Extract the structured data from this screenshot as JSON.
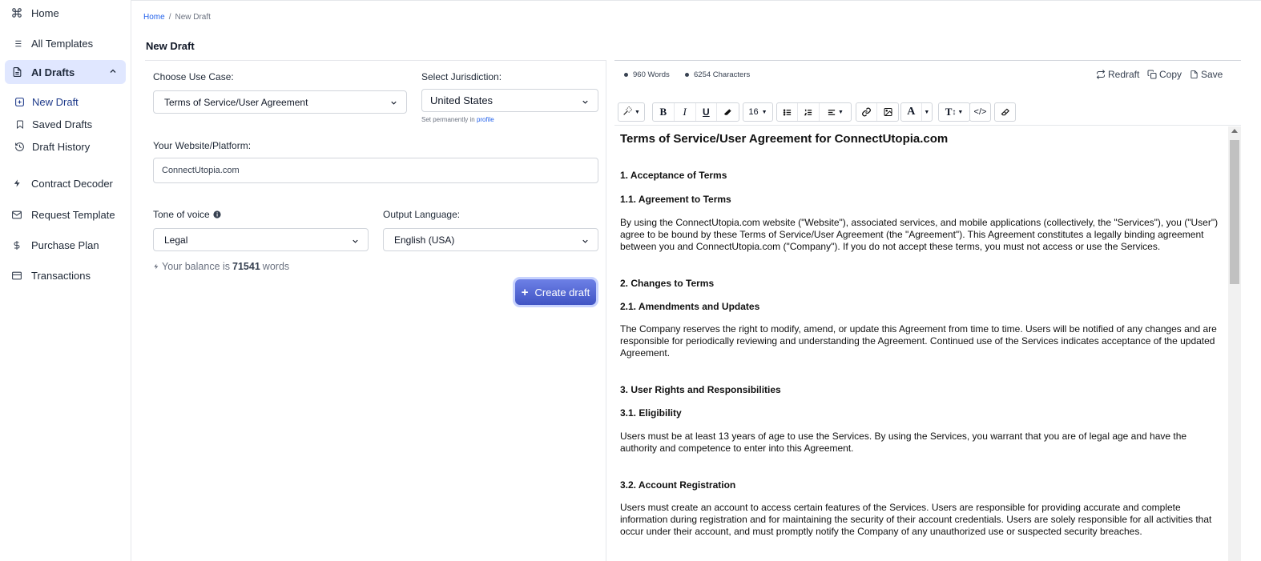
{
  "sidebar": {
    "items": [
      {
        "label": "Home"
      },
      {
        "label": "All Templates"
      },
      {
        "label": "AI Drafts"
      },
      {
        "label": "Contract Decoder"
      },
      {
        "label": "Request Template"
      },
      {
        "label": "Purchase Plan"
      },
      {
        "label": "Transactions"
      }
    ],
    "sub_items": [
      {
        "label": "New Draft"
      },
      {
        "label": "Saved Drafts"
      },
      {
        "label": "Draft History"
      }
    ]
  },
  "breadcrumb": {
    "home": "Home",
    "separator": "/",
    "current": "New Draft"
  },
  "page_title": "New Draft",
  "form": {
    "use_case_label": "Choose Use Case:",
    "use_case_value": "Terms of Service/User Agreement",
    "jurisdiction_label": "Select Jurisdiction:",
    "jurisdiction_value": "United States",
    "jurisdiction_hint": "Set permanently in",
    "jurisdiction_hint_link": "profile",
    "website_label": "Your Website/Platform:",
    "website_value": "ConnectUtopia.com",
    "tone_label": "Tone of voice",
    "tone_value": "Legal",
    "language_label": "Output Language:",
    "language_value": "English (USA)",
    "balance_prefix": "Your balance is",
    "balance_value": "71541",
    "balance_suffix": "words",
    "create_button": "Create draft"
  },
  "editor": {
    "words": "960 Words",
    "characters": "6254 Characters",
    "redraft": "Redraft",
    "copy": "Copy",
    "save": "Save",
    "font_size": "16",
    "document": {
      "title": "Terms of Service/User Agreement for ConnectUtopia.com",
      "s1": "1. Acceptance of Terms",
      "s1_1": "1.1. Agreement to Terms",
      "p1": "By using the ConnectUtopia.com website (\"Website\"), associated services, and mobile applications (collectively, the \"Services\"), you (\"User\") agree to be bound by these Terms of Service/User Agreement (the \"Agreement\"). This Agreement constitutes a legally binding agreement between you and ConnectUtopia.com (\"Company\"). If you do not accept these terms, you must not access or use the Services.",
      "s2": "2. Changes to Terms",
      "s2_1": "2.1. Amendments and Updates",
      "p2": "The Company reserves the right to modify, amend, or update this Agreement from time to time. Users will be notified of any changes and are responsible for periodically reviewing and understanding the Agreement. Continued use of the Services indicates acceptance of the updated Agreement.",
      "s3": "3. User Rights and Responsibilities",
      "s3_1": "3.1. Eligibility",
      "p3": "Users must be at least 13 years of age to use the Services. By using the Services, you warrant that you are of legal age and have the authority and competence to enter into this Agreement.",
      "s3_2": "3.2. Account Registration",
      "p4": "Users must create an account to access certain features of the Services. Users are responsible for providing accurate and complete information during registration and for maintaining the security of their account credentials. Users are solely responsible for all activities that occur under their account, and must promptly notify the Company of any unauthorized use or suspected security breaches."
    }
  },
  "colors": {
    "accent": "#4f63d6",
    "active_bg": "#e0e7ff",
    "link": "#2563eb"
  }
}
